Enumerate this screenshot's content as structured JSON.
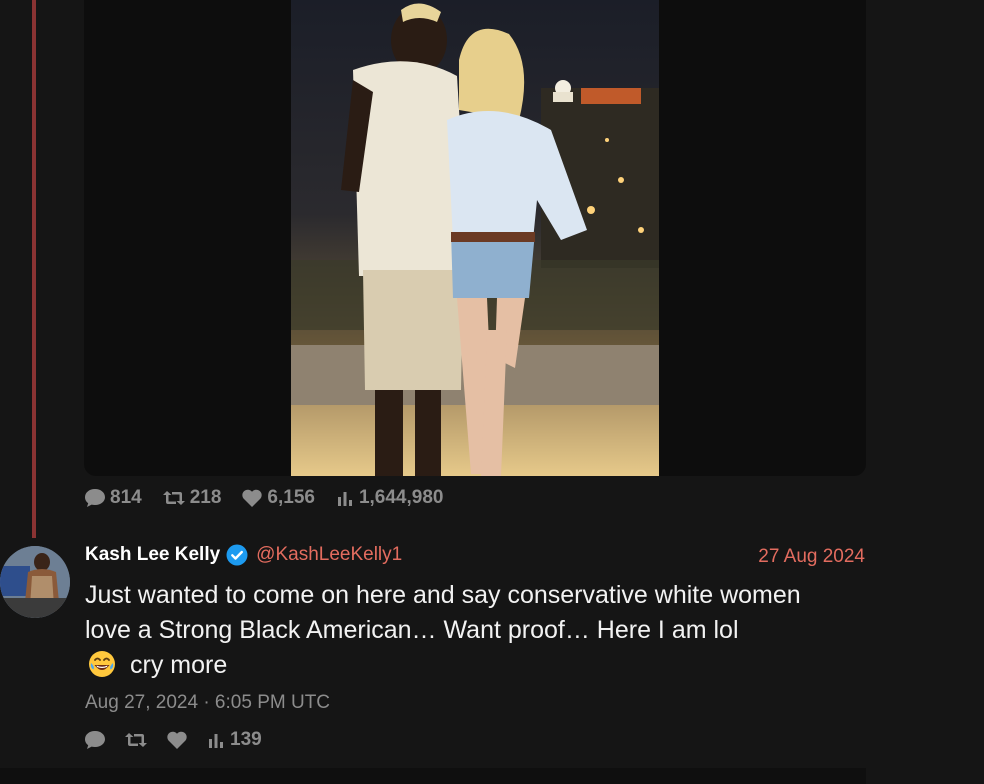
{
  "parent_tweet": {
    "stats": {
      "replies": "814",
      "retweets": "218",
      "likes": "6,156",
      "views": "1,644,980"
    }
  },
  "tweet": {
    "display_name": "Kash Lee Kelly",
    "handle": "@KashLeeKelly1",
    "date": "27 Aug 2024",
    "text_line1": "Just wanted to come on here and say conservative white women",
    "text_line2": "love a Strong Black American… Want proof… Here I am lol",
    "text_line3": "cry more",
    "emoji": "😂",
    "timestamp": "Aug 27, 2024 · 6:05 PM UTC",
    "stats": {
      "views": "139"
    }
  },
  "colors": {
    "accent": "#e36c5f",
    "muted": "#8c8c8c",
    "thread_line": "#8a3333",
    "verified": "#1d9bf0"
  }
}
